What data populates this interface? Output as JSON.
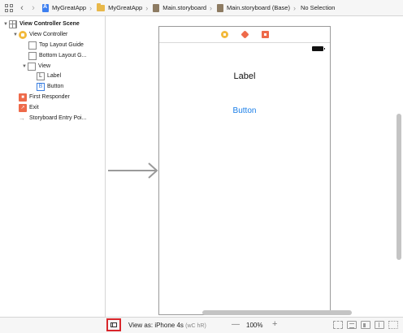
{
  "jumpbar": {
    "crumbs": [
      {
        "label": "MyGreatApp",
        "icon": "project-icon"
      },
      {
        "label": "MyGreatApp",
        "icon": "folder-icon"
      },
      {
        "label": "Main.storyboard",
        "icon": "storyboard-icon"
      },
      {
        "label": "Main.storyboard (Base)",
        "icon": "storyboard-icon"
      },
      {
        "label": "No Selection",
        "icon": ""
      }
    ]
  },
  "outline": {
    "scene": "View Controller Scene",
    "view_controller": "View Controller",
    "top_layout_guide": "Top Layout Guide",
    "bottom_layout_guide": "Bottom Layout G...",
    "view": "View",
    "label": "Label",
    "button": "Button",
    "first_responder": "First Responder",
    "exit": "Exit",
    "entry_point": "Storyboard Entry Poi..."
  },
  "canvas": {
    "label_text": "Label",
    "button_text": "Button"
  },
  "bottombar": {
    "view_as": "View as: iPhone 4s",
    "size_class": "(wC hR)",
    "zoom_minus": "—",
    "zoom": "100%",
    "zoom_plus": "+"
  },
  "colors": {
    "accent_blue": "#1a7ee8",
    "vc_yellow": "#f2b93b",
    "red_icon": "#ee6a4a",
    "highlight_red": "#d9262b"
  }
}
